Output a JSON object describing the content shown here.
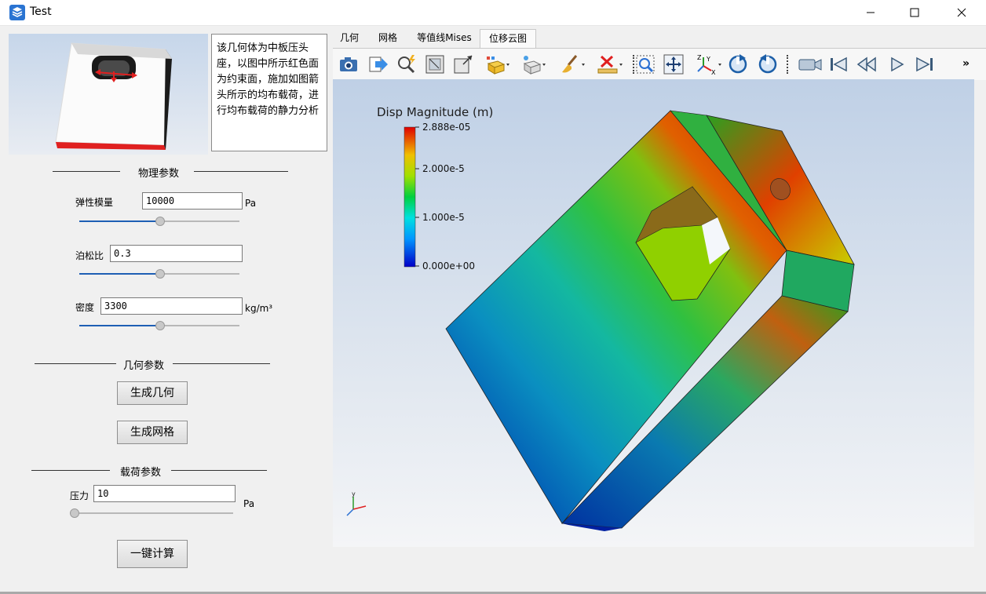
{
  "window": {
    "title": "Test"
  },
  "description": "该几何体为中板压头座，以图中所示红色面为约束面，施加如图箭头所示的均布载荷，进行均布载荷的静力分析",
  "physics": {
    "group_title": "物理参数",
    "elastic_modulus": {
      "label": "弹性模量",
      "value": "10000",
      "unit": "Pa",
      "slider_fraction": 0.5
    },
    "poisson_ratio": {
      "label": "泊松比",
      "value": "0.3",
      "slider_fraction": 0.5
    },
    "density": {
      "label": "密度",
      "value": "3300",
      "unit": "kg/m³",
      "slider_fraction": 0.5
    }
  },
  "geometry": {
    "group_title": "几何参数",
    "generate_geometry_label": "生成几何",
    "generate_mesh_label": "生成网格"
  },
  "load": {
    "group_title": "载荷参数",
    "pressure": {
      "label": "压力",
      "value": "10",
      "unit": "Pa",
      "slider_fraction": 0.0
    },
    "compute_label": "一键计算"
  },
  "tabs": [
    {
      "label": "几何"
    },
    {
      "label": "网格"
    },
    {
      "label": "等值线Mises"
    },
    {
      "label": "位移云图",
      "active": true
    }
  ],
  "toolbar": {
    "icons": [
      "camera-icon",
      "export-icon",
      "probe-icon",
      "fit-view-icon",
      "box-view-icon",
      "display-style-icon",
      "display-style2-icon",
      "brush-icon",
      "clear-icon",
      "zoom-box-icon",
      "pan-icon",
      "axes-icon",
      "rotate-cw-icon",
      "rotate-ccw-icon",
      "camera-record-icon",
      "first-frame-icon",
      "prev-frame-icon",
      "play-icon",
      "last-frame-icon"
    ],
    "overflow_label": "»"
  },
  "viewport": {
    "legend_title": "Disp Magnitude (m)",
    "legend_ticks": [
      "2.888e-05",
      "2.000e-5",
      "1.000e-5",
      "0.000e+00"
    ]
  },
  "colors": {
    "accent": "#1e5fb4",
    "legend_top": "#e00000",
    "legend_bottom": "#0000c8"
  }
}
